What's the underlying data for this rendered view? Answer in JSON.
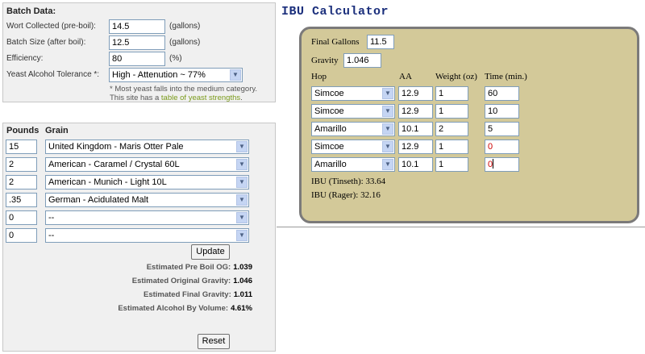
{
  "batch": {
    "heading": "Batch Data:",
    "wort_label": "Wort Collected (pre-boil):",
    "wort_value": "14.5",
    "wort_unit": "(gallons)",
    "size_label": "Batch Size (after boil):",
    "size_value": "12.5",
    "size_unit": "(gallons)",
    "eff_label": "Efficiency:",
    "eff_value": "80",
    "eff_unit": "(%)",
    "yeast_label": "Yeast Alcohol Tolerance *:",
    "yeast_value": "High - Attenution ~ 77%",
    "note_line1": "* Most yeast falls into the medium category.",
    "note_line2_pre": "This site has a",
    "note_link": "table of yeast strengths",
    "note_line2_post": "."
  },
  "grain": {
    "col_pounds": "Pounds",
    "col_grain": "Grain",
    "rows": [
      {
        "pounds": "15",
        "grain": "United Kingdom - Maris Otter Pale"
      },
      {
        "pounds": "2",
        "grain": "American - Caramel / Crystal 60L"
      },
      {
        "pounds": "2",
        "grain": "American - Munich - Light 10L"
      },
      {
        "pounds": ".35",
        "grain": "German - Acidulated Malt"
      },
      {
        "pounds": "0",
        "grain": "--"
      },
      {
        "pounds": "0",
        "grain": "--"
      }
    ],
    "update_label": "Update",
    "reset_label": "Reset",
    "estimates": [
      {
        "label": "Estimated Pre Boil OG:",
        "value": "1.039"
      },
      {
        "label": "Estimated Original Gravity:",
        "value": "1.046"
      },
      {
        "label": "Estimated Final Gravity:",
        "value": "1.011"
      },
      {
        "label": "Estimated Alcohol By Volume:",
        "value": "4.61%"
      }
    ]
  },
  "ibu": {
    "title": "IBU Calculator",
    "final_gallons_label": "Final Gallons",
    "final_gallons_value": "11.5",
    "gravity_label": "Gravity",
    "gravity_value": "1.046",
    "col_hop": "Hop",
    "col_aa": "AA",
    "col_weight": "Weight (oz)",
    "col_time": "Time (min.)",
    "hops": [
      {
        "hop": "Simcoe",
        "aa": "12.9",
        "weight": "1",
        "time": "60"
      },
      {
        "hop": "Simcoe",
        "aa": "12.9",
        "weight": "1",
        "time": "10"
      },
      {
        "hop": "Amarillo",
        "aa": "10.1",
        "weight": "2",
        "time": "5"
      },
      {
        "hop": "Simcoe",
        "aa": "12.9",
        "weight": "1",
        "time": "0"
      },
      {
        "hop": "Amarillo",
        "aa": "10.1",
        "weight": "1",
        "time": "0"
      }
    ],
    "tinseth": "IBU (Tinseth): 33.64",
    "rager": "IBU (Rager): 32.16"
  },
  "icons": {
    "dropdown": "chevron-down-icon"
  },
  "colors": {
    "panel_bg": "#d3c999",
    "title_blue": "#1b2f7c",
    "link_green": "#7a9a1a",
    "zero_time_red": "#cc0000"
  }
}
